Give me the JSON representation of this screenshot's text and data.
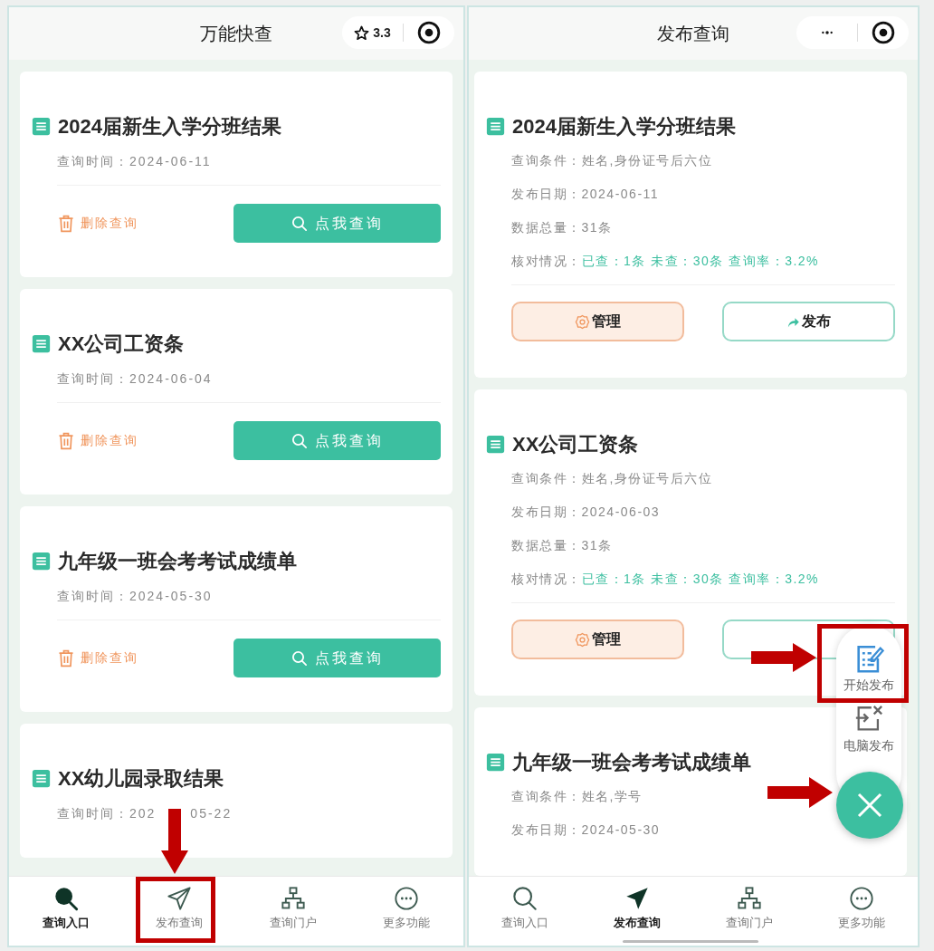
{
  "panels": [
    {
      "title": "万能快查",
      "capsule": {
        "kind": "rating",
        "rating": "3.3"
      },
      "cards": [
        {
          "kind": "query",
          "title": "2024届新生入学分班结果",
          "time": "查询时间：2024-06-11",
          "delete_label": "删除查询",
          "query_label": "点我查询"
        },
        {
          "kind": "query",
          "title": "XX公司工资条",
          "time": "查询时间：2024-06-04",
          "delete_label": "删除查询",
          "query_label": "点我查询"
        },
        {
          "kind": "query",
          "title": "九年级一班会考考试成绩单",
          "time": "查询时间：2024-05-30",
          "delete_label": "删除查询",
          "query_label": "点我查询"
        },
        {
          "kind": "query",
          "title": "XX幼儿园录取结果",
          "time": "查询时间：202",
          "time_tail": "05-22"
        }
      ],
      "nav": [
        {
          "label": "查询入口",
          "kind": "search",
          "selected": true
        },
        {
          "label": "发布查询",
          "kind": "send",
          "selected": false
        },
        {
          "label": "查询门户",
          "kind": "sitemap",
          "selected": false
        },
        {
          "label": "更多功能",
          "kind": "more",
          "selected": false
        }
      ]
    },
    {
      "title": "发布查询",
      "capsule": {
        "kind": "menu"
      },
      "cards": [
        {
          "kind": "publish",
          "title": "2024届新生入学分班结果",
          "fields": [
            {
              "label": "查询条件：",
              "value": "姓名,身份证号后六位",
              "highlight": false
            },
            {
              "label": "发布日期：",
              "value": "2024-06-11",
              "highlight": false
            },
            {
              "label": "数据总量：",
              "value": "31条",
              "highlight": false
            },
            {
              "label": "核对情况：",
              "value": "已查：1条 未查：30条 查询率：3.2%",
              "highlight": true
            }
          ],
          "manage_label": "管理",
          "publish_label": "发布"
        },
        {
          "kind": "publish",
          "title": "XX公司工资条",
          "fields": [
            {
              "label": "查询条件：",
              "value": "姓名,身份证号后六位",
              "highlight": false
            },
            {
              "label": "发布日期：",
              "value": "2024-06-03",
              "highlight": false
            },
            {
              "label": "数据总量：",
              "value": "31条",
              "highlight": false
            },
            {
              "label": "核对情况：",
              "value": "已查：1条 未查：30条 查询率：3.2%",
              "highlight": true
            }
          ],
          "manage_label": "管理"
        },
        {
          "kind": "publish",
          "title": "九年级一班会考考试成绩单",
          "fields": [
            {
              "label": "查询条件：",
              "value": "姓名,学号",
              "highlight": false
            },
            {
              "label": "发布日期：",
              "value": "2024-05-30",
              "highlight": false
            }
          ]
        }
      ],
      "fab_menu": [
        {
          "label": "开始发布",
          "kind": "edit"
        },
        {
          "label": "电脑发布",
          "kind": "computer"
        }
      ],
      "nav": [
        {
          "label": "查询入口",
          "kind": "search",
          "selected": false
        },
        {
          "label": "发布查询",
          "kind": "send",
          "selected": true
        },
        {
          "label": "查询门户",
          "kind": "sitemap",
          "selected": false
        },
        {
          "label": "更多功能",
          "kind": "more",
          "selected": false
        }
      ]
    }
  ]
}
